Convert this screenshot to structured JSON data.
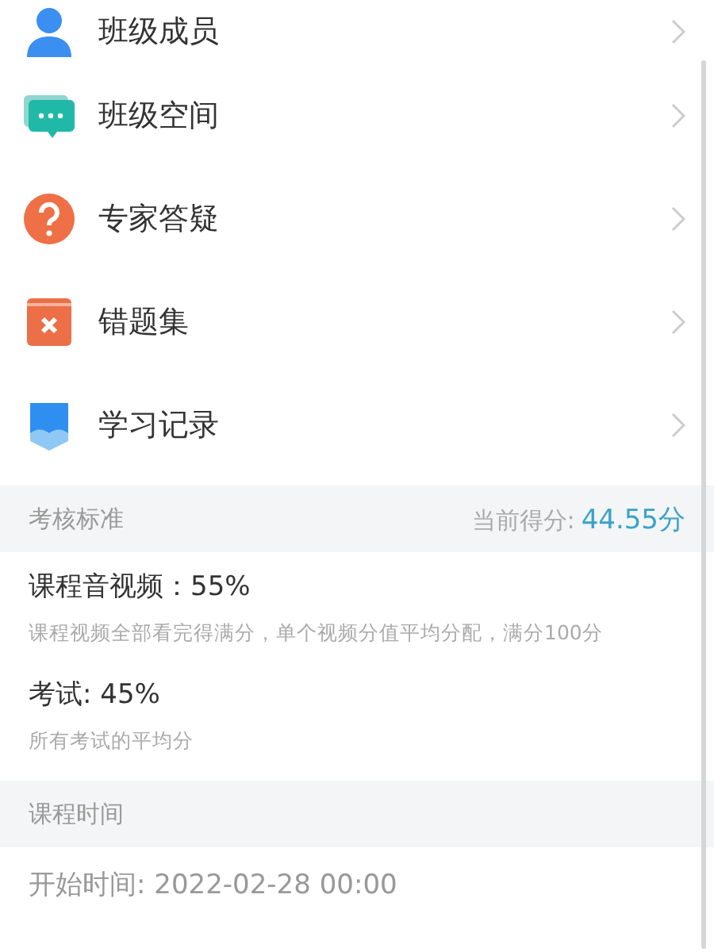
{
  "menu": [
    {
      "label": "班级成员",
      "kind": "members"
    },
    {
      "label": "班级空间",
      "kind": "space"
    },
    {
      "label": "专家答疑",
      "kind": "qa"
    },
    {
      "label": "错题集",
      "kind": "mistakes"
    },
    {
      "label": "学习记录",
      "kind": "records"
    }
  ],
  "assessment": {
    "title": "考核标准",
    "score_label": "当前得分:",
    "score_value": "44.55分",
    "criteria": [
      {
        "name": "课程音视频：55%",
        "description": "课程视频全部看完得满分，单个视频分值平均分配，满分100分"
      },
      {
        "name": "考试: 45%",
        "description": "所有考试的平均分"
      }
    ]
  },
  "schedule": {
    "title": "课程时间",
    "start": "开始时间: 2022-02-28 00:00"
  }
}
